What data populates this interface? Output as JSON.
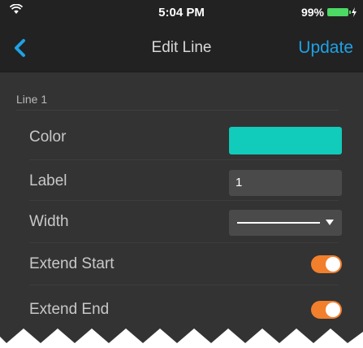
{
  "status_bar": {
    "time": "5:04 PM",
    "battery_percent": "99%",
    "icons": [
      "wifi-icon",
      "battery-icon",
      "charging-bolt-icon"
    ]
  },
  "nav": {
    "title": "Edit Line",
    "action": "Update",
    "back_icon": "chevron-left-icon"
  },
  "section": {
    "title": "Line 1"
  },
  "fields": {
    "color": {
      "label": "Color",
      "value": "#11cbbb"
    },
    "label": {
      "label": "Label",
      "value": "1"
    },
    "width": {
      "label": "Width",
      "icon": "line-width-icon",
      "dropdown_icon": "caret-down-icon"
    },
    "extend_start": {
      "label": "Extend Start",
      "on": true
    },
    "extend_end": {
      "label": "Extend End",
      "on": true
    }
  },
  "colors": {
    "accent_blue": "#1fa1e6",
    "toggle_orange": "#f27f2c",
    "background": "#333333",
    "nav_background": "#222222"
  }
}
